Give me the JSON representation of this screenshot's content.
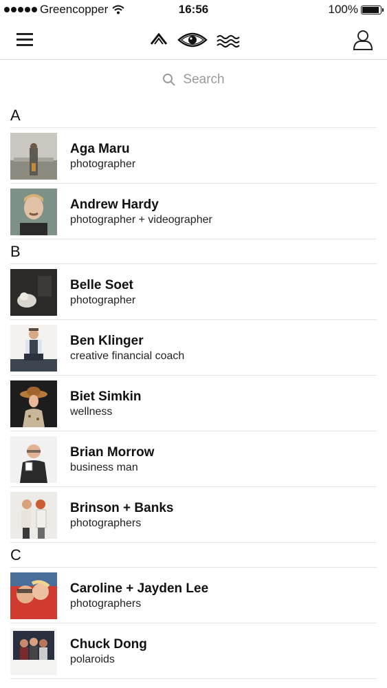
{
  "status_bar": {
    "carrier": "Greencopper",
    "time": "16:56",
    "battery_text": "100%",
    "battery_level": 1.0
  },
  "navbar": {
    "menu_icon": "hamburger-menu-icon",
    "logo_icon": "eye-logo-icon",
    "profile_icon": "user-profile-icon"
  },
  "search": {
    "placeholder": "Search",
    "icon": "search-icon"
  },
  "colors": {
    "text": "#111111",
    "muted": "#9a9a9a",
    "divider": "#e2e2e2"
  },
  "sections": [
    {
      "letter": "A",
      "contacts": [
        {
          "name": "Aga Maru",
          "role": "photographer",
          "thumb": "photo-portrait-cityscape"
        },
        {
          "name": "Andrew Hardy",
          "role": "photographer + videographer",
          "thumb": "photo-portrait-man"
        }
      ]
    },
    {
      "letter": "B",
      "contacts": [
        {
          "name": "Belle Soet",
          "role": "photographer",
          "thumb": "photo-dark-scene"
        },
        {
          "name": "Ben Klinger",
          "role": "creative financial coach",
          "thumb": "photo-seated-man"
        },
        {
          "name": "Biet Simkin",
          "role": "wellness",
          "thumb": "photo-woman-hat"
        },
        {
          "name": "Brian Morrow",
          "role": "business man",
          "thumb": "photo-man-mug"
        },
        {
          "name": "Brinson + Banks",
          "role": "photographers",
          "thumb": "photo-couple"
        }
      ]
    },
    {
      "letter": "C",
      "contacts": [
        {
          "name": "Caroline + Jayden Lee",
          "role": "photographers",
          "thumb": "photo-couple-selfie"
        },
        {
          "name": "Chuck Dong",
          "role": "polaroids",
          "thumb": "photo-polaroid-group"
        }
      ]
    }
  ]
}
